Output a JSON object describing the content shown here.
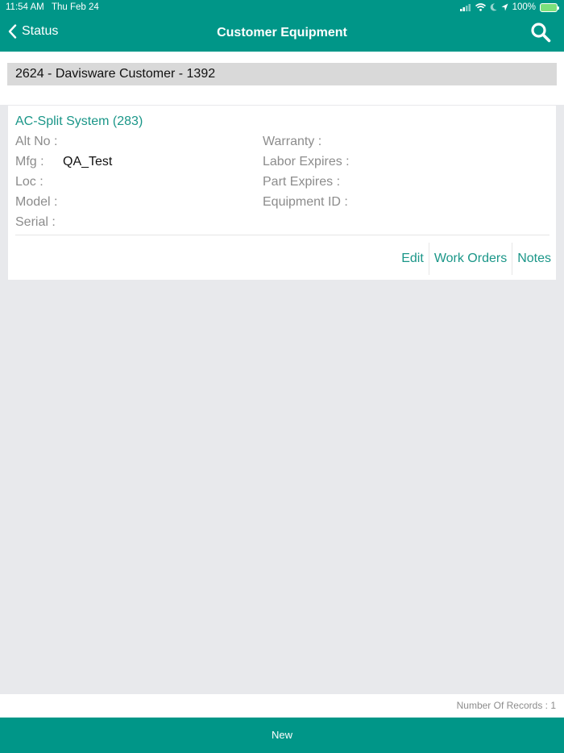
{
  "status_bar": {
    "time": "11:54 AM",
    "date": "Thu Feb 24",
    "battery": "100%",
    "icons": [
      "signal-icon",
      "wifi-icon",
      "moon-icon",
      "location-arrow-icon",
      "battery-charging-icon"
    ]
  },
  "nav": {
    "back_label": "Status",
    "title": "Customer Equipment",
    "search_icon": "search-icon",
    "accent_color": "#009688"
  },
  "customer": {
    "label": "2624 - Davisware Customer - 1392"
  },
  "equipment": {
    "title": "AC-Split System (283)",
    "fields_left": [
      {
        "label": "Alt No :",
        "value": ""
      },
      {
        "label": "Mfg :",
        "value": "QA_Test"
      },
      {
        "label": "Loc :",
        "value": ""
      },
      {
        "label": "Model :",
        "value": ""
      },
      {
        "label": "Serial :",
        "value": ""
      }
    ],
    "fields_right": [
      {
        "label": "Warranty :",
        "value": ""
      },
      {
        "label": "Labor Expires :",
        "value": ""
      },
      {
        "label": "Part Expires :",
        "value": ""
      },
      {
        "label": "Equipment ID :",
        "value": ""
      }
    ],
    "actions": [
      "Edit",
      "Work Orders",
      "Notes"
    ]
  },
  "footer": {
    "records": "Number Of Records : 1",
    "new_label": "New"
  }
}
